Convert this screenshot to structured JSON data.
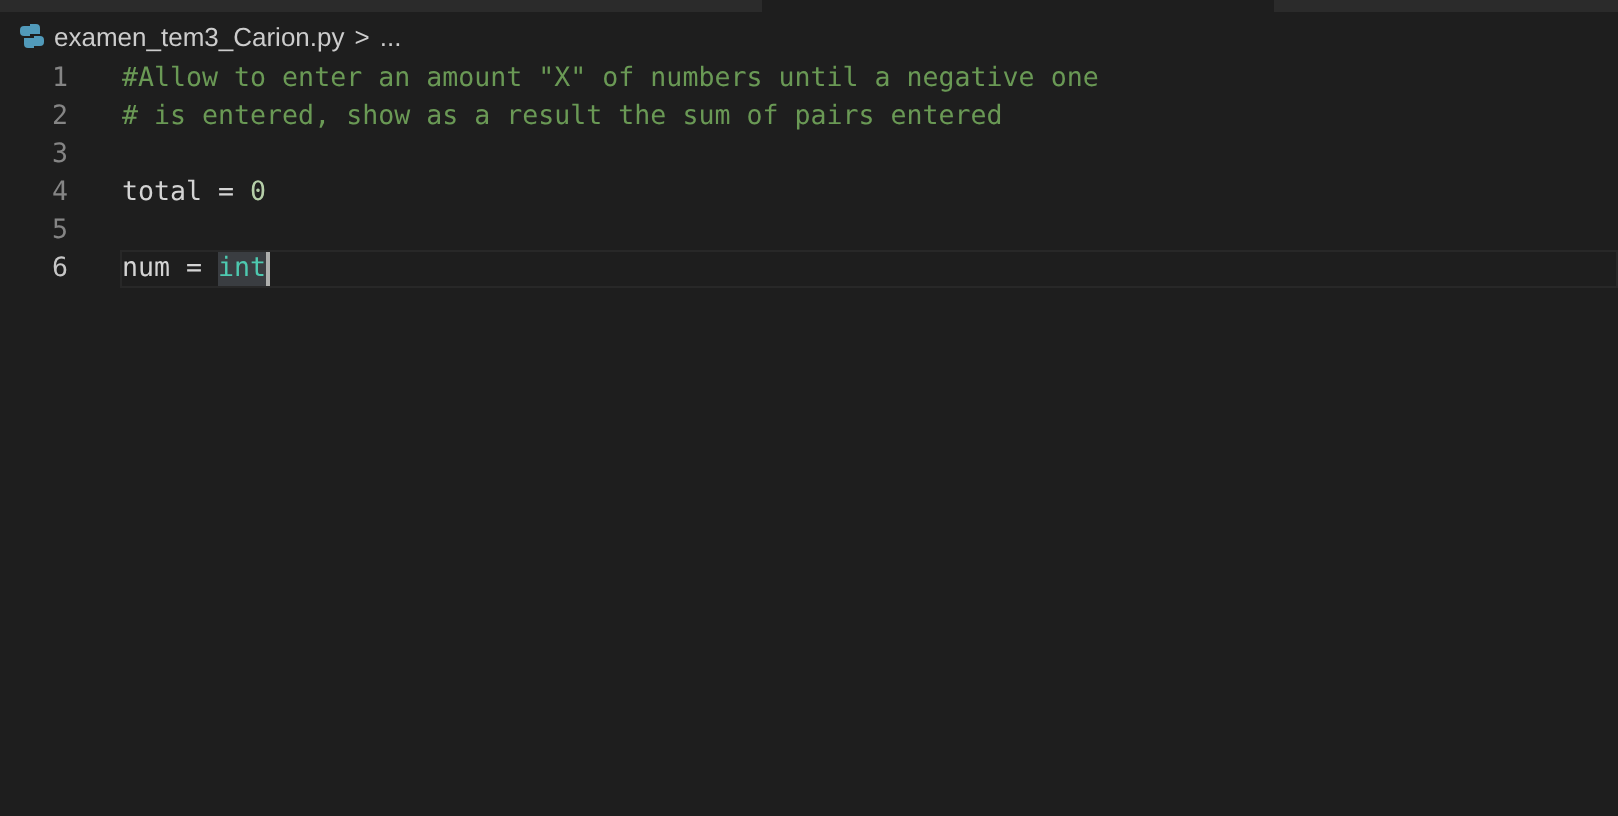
{
  "breadcrumb": {
    "file": "examen_tem3_Carion.py",
    "separator": ">",
    "more": "..."
  },
  "lines": [
    {
      "number": "1",
      "current": false,
      "tokens": [
        {
          "kind": "comment",
          "text": "#Allow to enter an amount \"X\" of numbers until a negative one",
          "highlighted": false
        }
      ]
    },
    {
      "number": "2",
      "current": false,
      "tokens": [
        {
          "kind": "comment",
          "text": "# is entered, show as a result the sum of pairs entered",
          "highlighted": false
        }
      ]
    },
    {
      "number": "3",
      "current": false
    },
    {
      "number": "4",
      "current": false,
      "tokens": [
        {
          "kind": "plain",
          "text": "total = ",
          "highlighted": false
        },
        {
          "kind": "number",
          "text": "0",
          "highlighted": false
        }
      ]
    },
    {
      "number": "5",
      "current": false
    },
    {
      "number": "6",
      "current": true,
      "cursor": true,
      "tokens": [
        {
          "kind": "plain",
          "text": "num = ",
          "highlighted": false
        },
        {
          "kind": "builtin",
          "text": "int",
          "highlighted": true
        }
      ]
    }
  ]
}
